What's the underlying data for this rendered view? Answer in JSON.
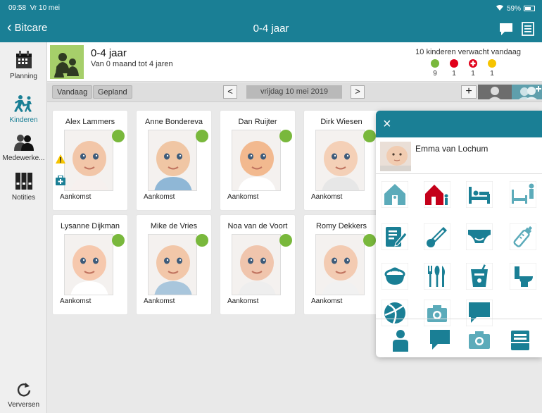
{
  "status": {
    "time": "09:58",
    "date": "Vr 10 mei",
    "battery": "59%"
  },
  "nav": {
    "back_label": "Bitcare",
    "title": "0-4 jaar"
  },
  "sidebar": {
    "items": [
      {
        "label": "Planning",
        "icon": "calendar-icon"
      },
      {
        "label": "Kinderen",
        "icon": "children-running-icon"
      },
      {
        "label": "Medewerke...",
        "icon": "employees-icon"
      },
      {
        "label": "Notities",
        "icon": "notes-binders-icon"
      }
    ],
    "refresh_label": "Verversen"
  },
  "group": {
    "name": "0-4 jaar",
    "subtitle": "Van 0 maand tot 4 jaren",
    "expected": "10 kinderen verwacht vandaag",
    "stats": [
      {
        "count": "9",
        "color": "#79b83c"
      },
      {
        "count": "1",
        "color": "#e1001a"
      },
      {
        "count": "1",
        "color": "#e1001a"
      },
      {
        "count": "1",
        "color": "#f6c400"
      }
    ]
  },
  "toolbar": {
    "today_label": "Vandaag",
    "planned_label": "Gepland",
    "date": "vrijdag 10 mei 2019",
    "prev": "<",
    "next": ">",
    "add": "+"
  },
  "children": [
    {
      "name": "Alex Lammers",
      "status": "Aankomst",
      "skin": "#f2c6a8",
      "shirt": "#f6f0ee",
      "alert": true
    },
    {
      "name": "Anne Bondereva",
      "status": "Aankomst",
      "skin": "#f0c6a4",
      "shirt": "#8fb7d6",
      "alert": false
    },
    {
      "name": "Dan Ruijter",
      "status": "Aankomst",
      "skin": "#f2b98f",
      "shirt": "#ffffff",
      "alert": false
    },
    {
      "name": "Dirk Wiesen",
      "status": "Aankomst",
      "skin": "#f4d0b7",
      "shirt": "#e7e7e7",
      "alert": false
    },
    {
      "name": "Lysanne Dijkman",
      "status": "Aankomst",
      "skin": "#f6c8ad",
      "shirt": "#ffffff",
      "alert": false
    },
    {
      "name": "Mike de Vries",
      "status": "Aankomst",
      "skin": "#f2c7a9",
      "shirt": "#a9c6dc",
      "alert": false
    },
    {
      "name": "Noa van de Voort",
      "status": "Aankomst",
      "skin": "#f0c5ad",
      "shirt": "#eeeeee",
      "alert": false
    },
    {
      "name": "Romy Dekkers",
      "status": "Aankomst",
      "skin": "#f3cbb2",
      "shirt": "#f1f1f1",
      "alert": false
    }
  ],
  "panel": {
    "close": "×",
    "child_name": "Emma van Lochum",
    "actions": [
      "arrival-house-icon",
      "departure-house-icon",
      "bed-icon",
      "wake-up-icon",
      "report-edit-icon",
      "thermometer-icon",
      "diaper-icon",
      "bottle-icon",
      "potty-icon",
      "meal-icon",
      "drink-icon",
      "toilet-icon",
      "ball-play-icon",
      "camera-icon",
      "message-icon"
    ],
    "bottom": [
      "child-profile-icon",
      "chat-icon",
      "photo-icon",
      "file-icon"
    ]
  },
  "colors": {
    "brand": "#1a7f95",
    "present": "#79b83c",
    "action_dim": "#5cabba"
  }
}
